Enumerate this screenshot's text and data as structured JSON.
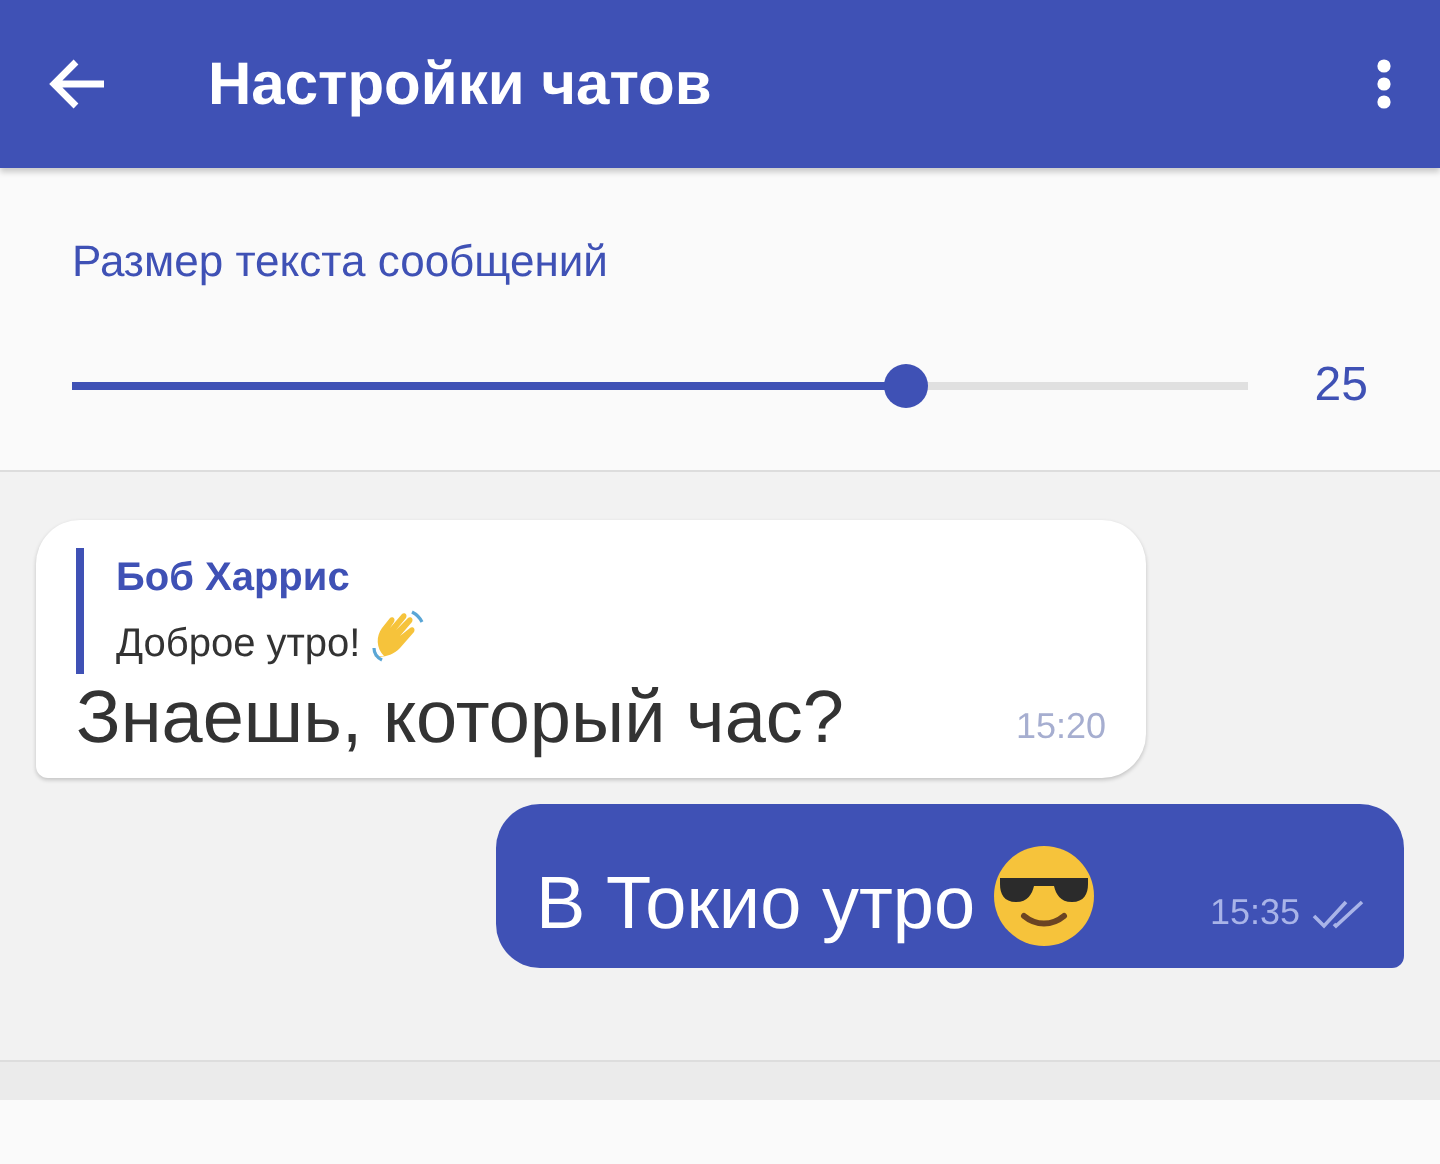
{
  "toolbar": {
    "title": "Настройки чатов"
  },
  "text_size": {
    "label": "Размер текста сообщений",
    "level": 0.71,
    "reading": "25"
  },
  "messages": [
    {
      "kind": "incoming",
      "reply_author": "Боб Харрис",
      "reply_text": "Доброе утро!",
      "text": "Знаешь, который час?",
      "time": "15:20"
    },
    {
      "kind": "outgoing",
      "text": "В Токио утро",
      "time": "15:35",
      "read": true
    }
  ]
}
